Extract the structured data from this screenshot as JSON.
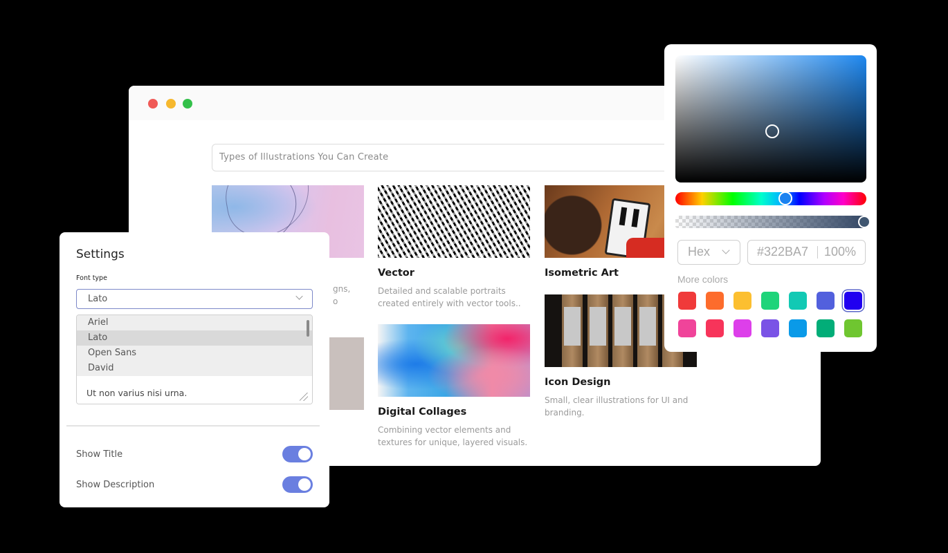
{
  "window": {
    "traffic_lights": [
      "close",
      "minimize",
      "maximize"
    ],
    "search": {
      "placeholder": "Types of Illustrations You Can Create"
    },
    "cards": [
      {
        "image": "abstract-lines",
        "title": "",
        "desc_fragment_1": "gns,",
        "desc_fragment_2": "o"
      },
      {
        "image": "vector-pattern",
        "title": "Vector",
        "description": "Detailed and scalable portraits created entirely with vector tools.."
      },
      {
        "image": "tablet-drawing",
        "title": "Isometric Art",
        "description": ""
      },
      {
        "image": "flower-sticker",
        "title": "",
        "description": ""
      },
      {
        "image": "paint-collage",
        "title": "Digital Collages",
        "description": "Combining vector elements and textures for unique, layered visuals."
      },
      {
        "image": "poster-tubes",
        "title": "Icon Design",
        "description": "Small, clear illustrations for UI and branding."
      }
    ]
  },
  "settings": {
    "heading": "Settings",
    "font_type_label": "Font type",
    "font_selected": "Lato",
    "font_options": [
      "Ariel",
      "Lato",
      "Open Sans",
      "David"
    ],
    "textarea_value": "Ut non varius nisi urna.",
    "toggles": [
      {
        "label": "Show Title",
        "on": true
      },
      {
        "label": "Show Description",
        "on": true
      }
    ],
    "accent_color": "#6a7fe0"
  },
  "color_picker": {
    "mode": "Hex",
    "hex_value": "#322BA7",
    "opacity": "100%",
    "more_colors_label": "More colors",
    "swatches": [
      "#f03a3a",
      "#fd6c2c",
      "#fcbf30",
      "#1fd47a",
      "#12c9b4",
      "#5260dd",
      "#2000f0",
      "#f0449a",
      "#f7345a",
      "#dd3fea",
      "#7a53e6",
      "#0a9ae8",
      "#02ad78",
      "#6fc630"
    ],
    "active_swatch_index": 6
  }
}
